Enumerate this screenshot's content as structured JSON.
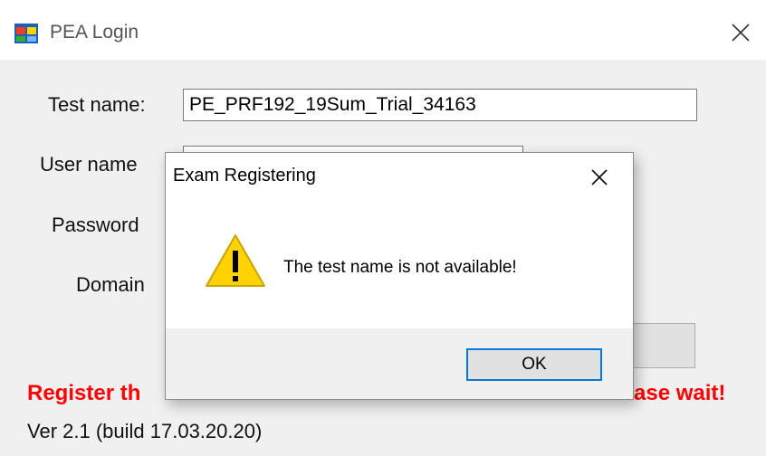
{
  "window": {
    "title": "PEA Login",
    "icon": "app-window-icon",
    "close_icon": "close-icon"
  },
  "form": {
    "test_name_label": "Test name:",
    "test_name_value": "PE_PRF192_19Sum_Trial_34163",
    "user_name_label": "User name",
    "user_name_value": "",
    "password_label": "Password",
    "password_value": "",
    "domain_label": "Domain",
    "domain_value": "",
    "login_button_label": ""
  },
  "status": {
    "left_text": "Register th",
    "right_text": "ase wait!",
    "color": "#ff0000"
  },
  "version": {
    "text": "Ver 2.1 (build 17.03.20.20)"
  },
  "dialog": {
    "title": "Exam Registering",
    "message": "The test name is not available!",
    "ok_label": "OK",
    "icon": "warning-icon",
    "close_icon": "close-icon",
    "accent": "#0078d7"
  }
}
